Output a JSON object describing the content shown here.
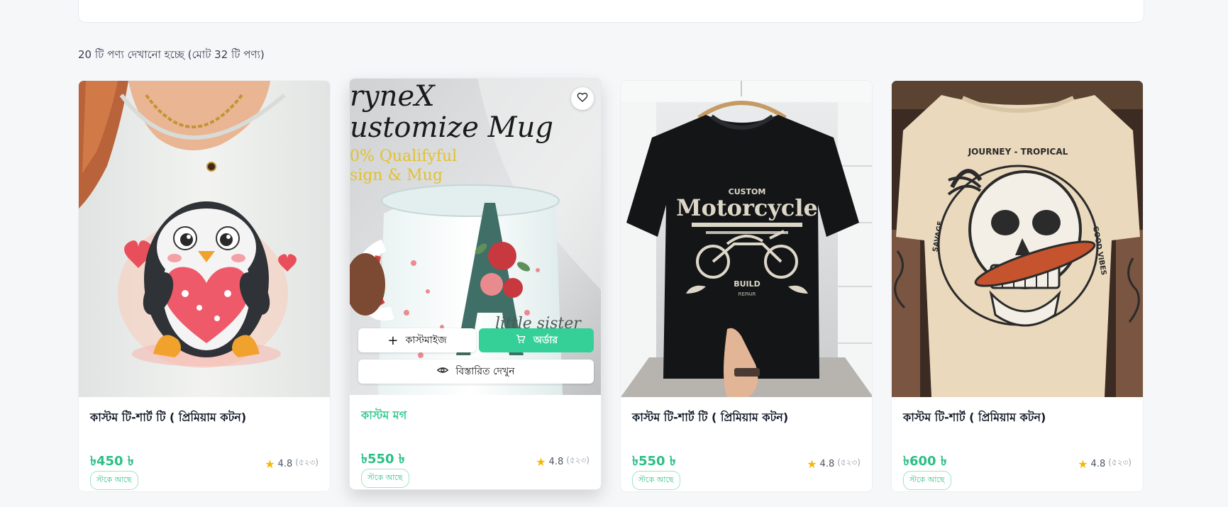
{
  "results": {
    "summary": "20 টি পণ্য দেখানো হচ্ছে (মোট 32 টি পণ্য)"
  },
  "colors": {
    "accent": "#34d097",
    "price": "#2bbf86"
  },
  "products": [
    {
      "title": "কাস্টম টি-শার্ট টি ( প্রিমিয়াম কটন)",
      "price": "৳450 ৳",
      "stock": "স্টকে আছে",
      "rating": "4.8",
      "reviews": "(৫২৩)"
    },
    {
      "title": "কাস্টম মগ",
      "price": "৳550 ৳",
      "stock": "স্টকে আছে",
      "rating": "4.8",
      "reviews": "(৫২৩)",
      "image_text": {
        "brand": "ryneX",
        "line1": "ustomize Mug",
        "line2": "0% Qualifyful",
        "line3": "sign & Mug",
        "mug_text": "little sister"
      },
      "actions": {
        "customize": "কাস্টমাইজ",
        "order": "অর্ডার",
        "details": "বিস্তারিত দেখুন"
      }
    },
    {
      "title": "কাস্টম টি-শার্ট টি ( প্রিমিয়াম কটন)",
      "price": "৳550 ৳",
      "stock": "স্টকে আছে",
      "rating": "4.8",
      "reviews": "(৫২৩)",
      "image_text": {
        "custom": "CUSTOM",
        "main": "Motorcycle",
        "build": "BUILD",
        "repair": "REPAIR"
      }
    },
    {
      "title": "কাস্টম টি-শার্ট ( প্রিমিয়াম কটন)",
      "price": "৳600 ৳",
      "stock": "স্টকে আছে",
      "rating": "4.8",
      "reviews": "(৫২৩)",
      "image_text": {
        "top": "JOURNEY - TROPICAL",
        "right": "GOOD VIBES",
        "left": "SAVAGE"
      }
    }
  ]
}
